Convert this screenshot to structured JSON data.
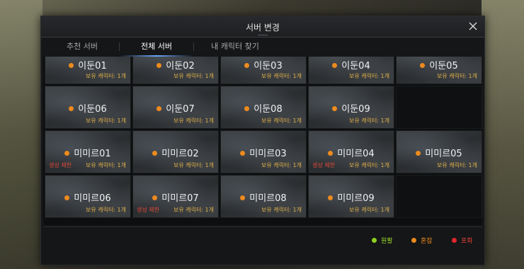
{
  "window": {
    "title": "서버 변경"
  },
  "tabs": [
    {
      "label": "추천 서버"
    },
    {
      "label": "전체 서버"
    },
    {
      "label": "내 캐릭터 찾기"
    }
  ],
  "status_colors": {
    "smooth": "#8ed11f",
    "busy": "#ee8a1e",
    "full": "#e0252b"
  },
  "servers": [
    {
      "name": "이둔01",
      "status": "busy",
      "count": "보유 캐릭터: 1개"
    },
    {
      "name": "이둔02",
      "status": "busy",
      "count": "보유 캐릭터: 1개"
    },
    {
      "name": "이둔03",
      "status": "busy",
      "count": "보유 캐릭터: 1개"
    },
    {
      "name": "이둔04",
      "status": "busy",
      "count": "보유 캐릭터: 1개"
    },
    {
      "name": "이둔05",
      "status": "busy",
      "count": "보유 캐릭터: 1개"
    },
    {
      "name": "이둔06",
      "status": "busy",
      "count": "보유 캐릭터: 1개"
    },
    {
      "name": "이둔07",
      "status": "busy",
      "count": "보유 캐릭터: 1개"
    },
    {
      "name": "이둔08",
      "status": "busy",
      "count": "보유 캐릭터: 1개"
    },
    {
      "name": "이둔09",
      "status": "busy",
      "count": "보유 캐릭터: 1개"
    },
    {
      "name": "미미르01",
      "status": "busy",
      "count": "보유 캐릭터: 1개",
      "restriction": "생성 제한"
    },
    {
      "name": "미미르02",
      "status": "busy",
      "count": "보유 캐릭터: 1개"
    },
    {
      "name": "미미르03",
      "status": "busy",
      "count": "보유 캐릭터: 1개"
    },
    {
      "name": "미미르04",
      "status": "busy",
      "count": "보유 캐릭터: 1개",
      "restriction": "생성 제한"
    },
    {
      "name": "미미르05",
      "status": "busy",
      "count": "보유 캐릭터: 1개"
    },
    {
      "name": "미미르06",
      "status": "busy",
      "count": "보유 캐릭터: 1개"
    },
    {
      "name": "미미르07",
      "status": "busy",
      "count": "보유 캐릭터: 1개",
      "restriction": "생성 제한"
    },
    {
      "name": "미미르08",
      "status": "busy",
      "count": "보유 캐릭터: 1개"
    },
    {
      "name": "미미르09",
      "status": "busy",
      "count": "보유 캐릭터: 1개"
    }
  ],
  "legend": [
    {
      "label": "원활",
      "status": "smooth"
    },
    {
      "label": "혼잡",
      "status": "busy"
    },
    {
      "label": "포화",
      "status": "full"
    }
  ]
}
